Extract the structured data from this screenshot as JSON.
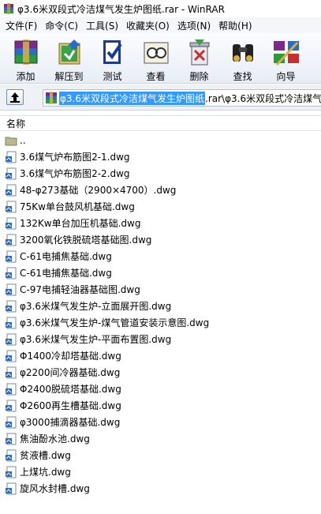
{
  "window": {
    "title": "φ3.6米双段式冷洁煤气发生炉图纸.rar - WinRAR"
  },
  "menu": [
    "文件(F)",
    "命令(C)",
    "工具(S)",
    "收藏夹(O)",
    "选项(N)",
    "帮助(H)"
  ],
  "toolbar": [
    {
      "label": "添加",
      "icon": "add-archive-icon"
    },
    {
      "label": "解压到",
      "icon": "extract-icon"
    },
    {
      "label": "测试",
      "icon": "test-icon"
    },
    {
      "label": "查看",
      "icon": "view-icon"
    },
    {
      "label": "删除",
      "icon": "delete-icon"
    },
    {
      "label": "查找",
      "icon": "find-icon"
    },
    {
      "label": "向导",
      "icon": "wizard-icon"
    }
  ],
  "address": {
    "selected": "φ3.6米双段式冷洁煤气发生炉图纸",
    "rest": ".rar\\φ3.6米双段式冷洁煤气"
  },
  "column_header": "名称",
  "files": [
    "..",
    "3.6煤气炉布筋图2-1.dwg",
    "3.6煤气炉布筋图2-2.dwg",
    "48-φ273基础（2900×4700）.dwg",
    "75Kw单台鼓风机基础.dwg",
    "132Kw单台加压机基础.dwg",
    "3200氧化铁脱硫塔基础图.dwg",
    "C-61电捕焦基础.dwg",
    "C-61电捕焦基础.dwg",
    "C-97电捕轻油器基础图.dwg",
    "φ3.6米煤气发生炉-立面展开图.dwg",
    "φ3.6米煤气发生炉-煤气管道安装示意图.dwg",
    "φ3.6米煤气发生炉-平面布置图.dwg",
    "Φ1400冷却塔基础.dwg",
    "φ2200间冷器基础.dwg",
    "Φ2400脱硫塔基础.dwg",
    "Φ2600再生槽基础.dwg",
    "φ3000捕滴器基础.dwg",
    "焦油酚水池.dwg",
    "贫液槽.dwg",
    "上煤坑.dwg",
    "旋风水封槽.dwg"
  ]
}
